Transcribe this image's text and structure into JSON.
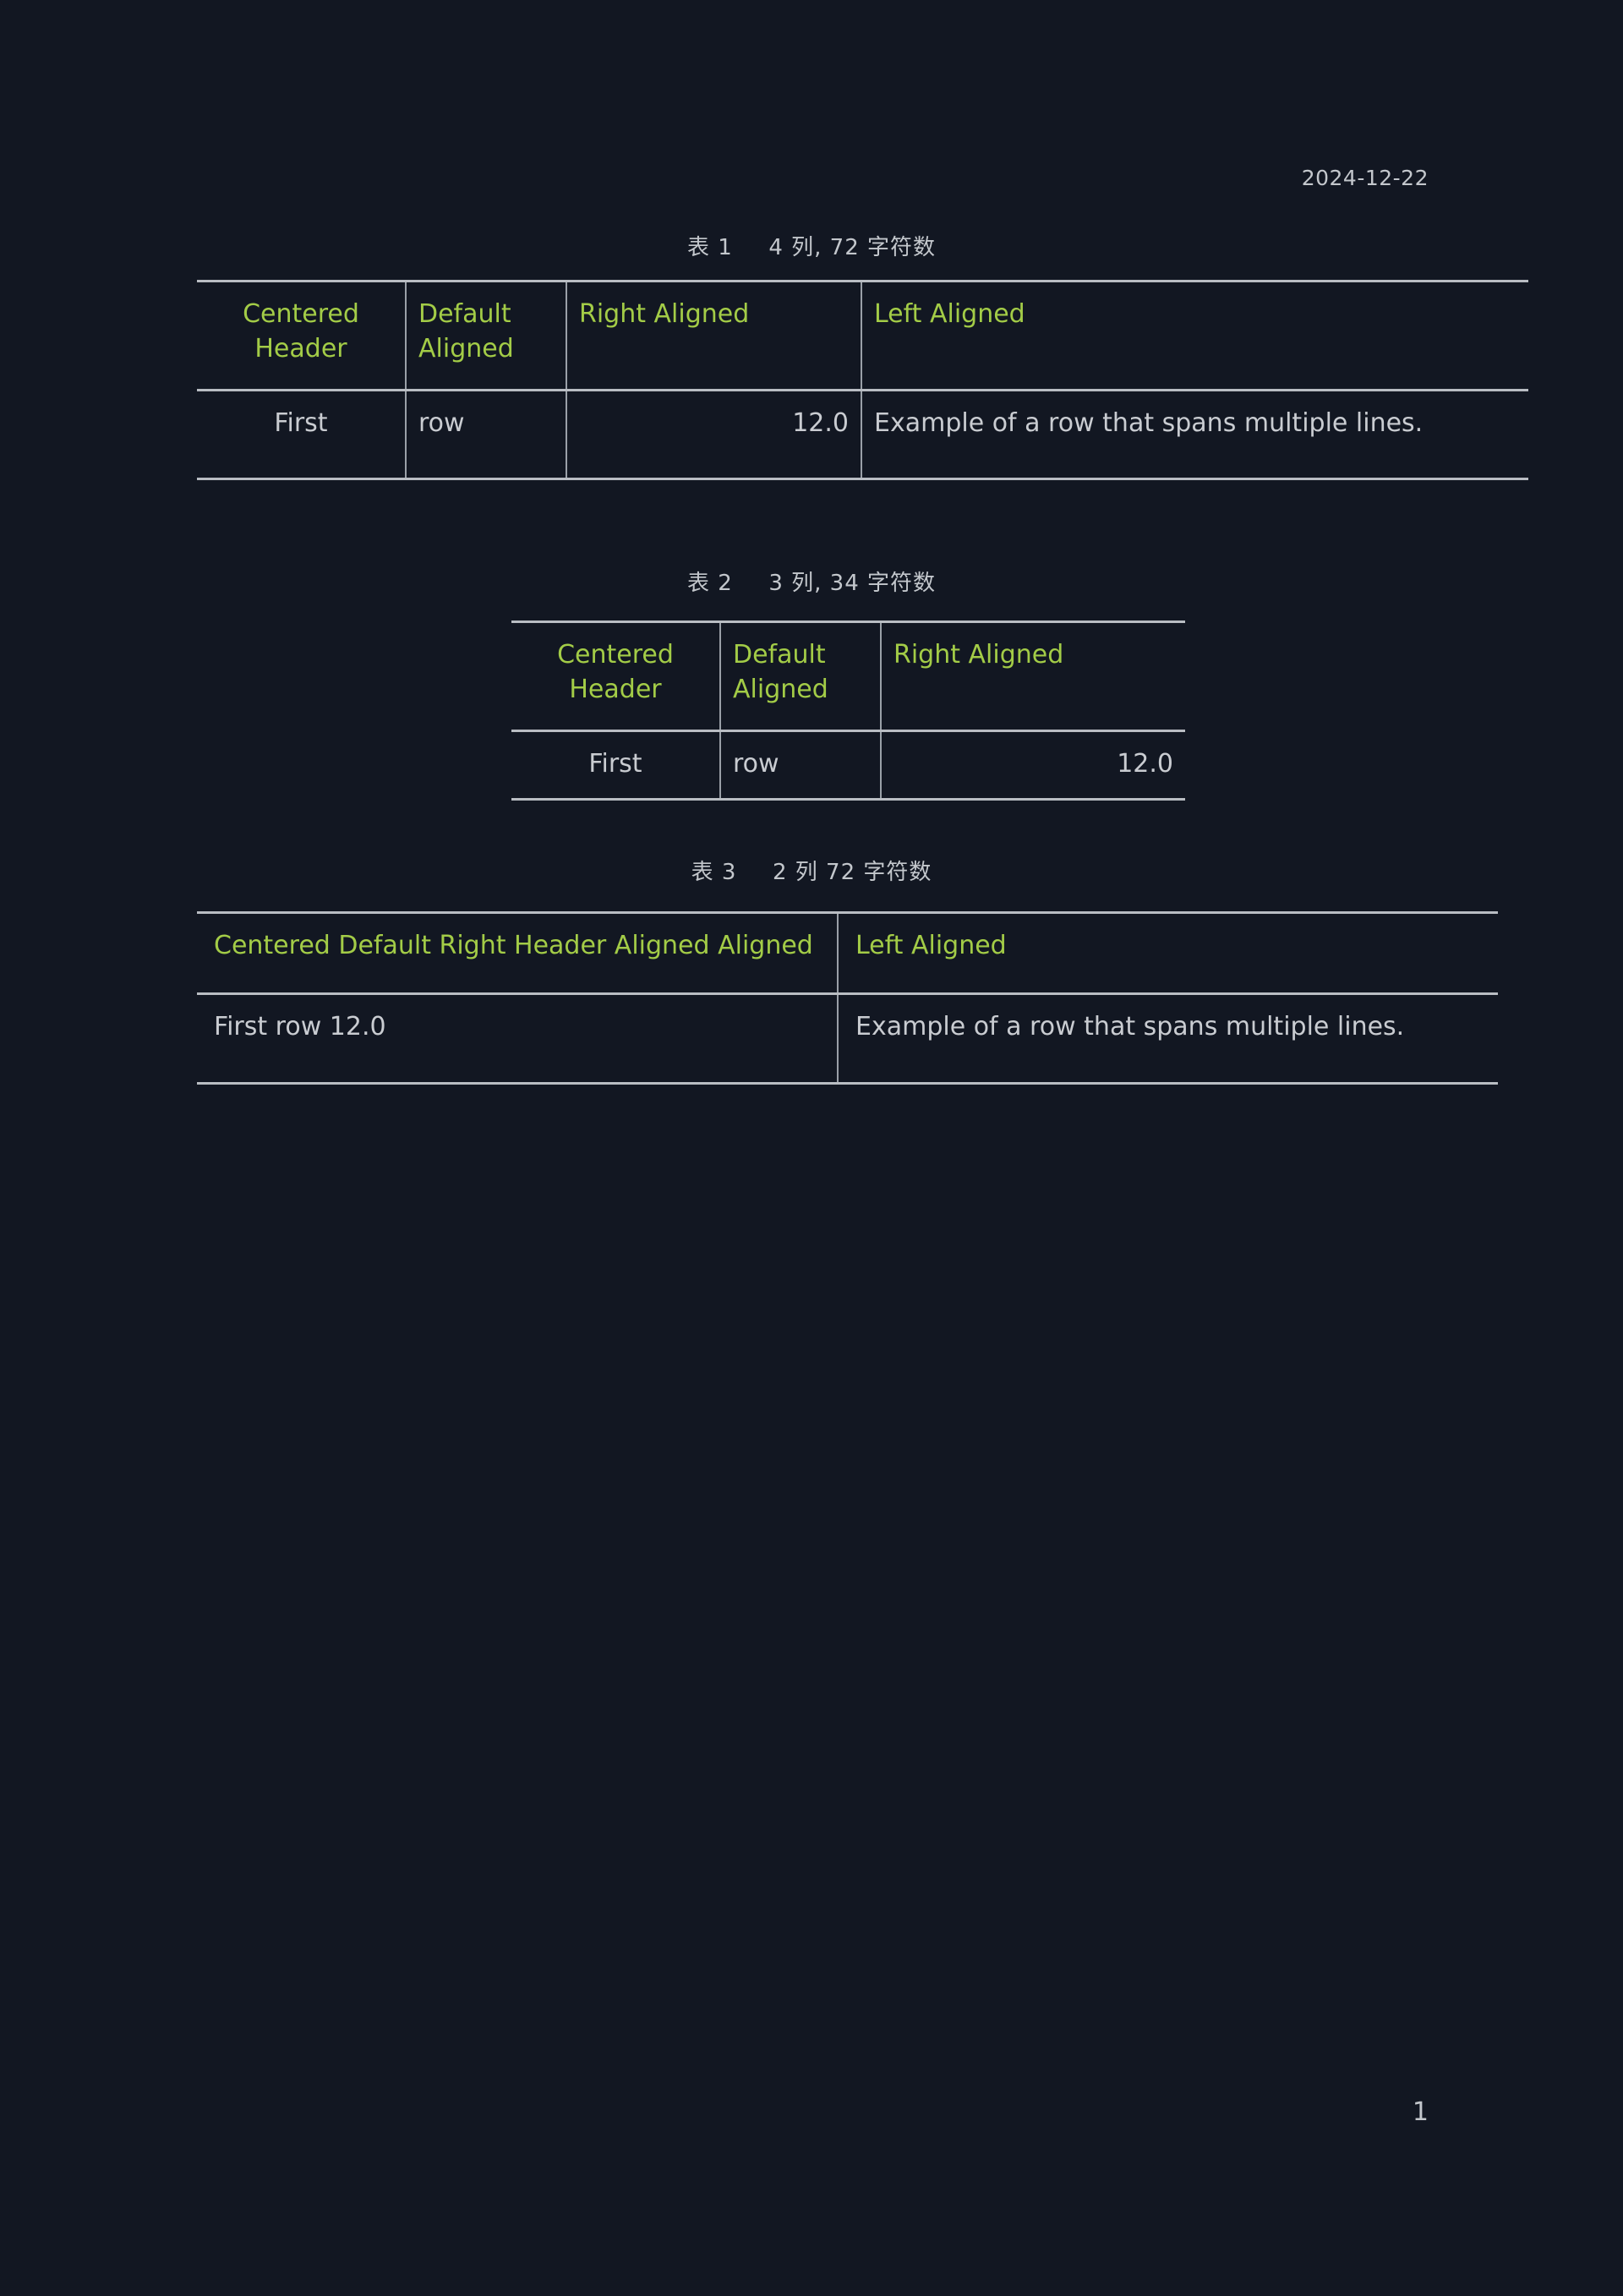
{
  "document": {
    "date": "2024-12-22",
    "page_number": "1",
    "background_color": "#121722",
    "header_color": "#a3cc47",
    "body_color": "#c9ccd1",
    "rule_color": "#b9bdc3"
  },
  "tables": [
    {
      "caption": {
        "label": "表 1",
        "text": "4 列, 72 字符数"
      },
      "columns": 4,
      "headers": [
        {
          "text": "Centered Header",
          "align": "center"
        },
        {
          "text": "Default Aligned",
          "align": "left"
        },
        {
          "text": "Right Aligned",
          "align": "left"
        },
        {
          "text": "Left Aligned",
          "align": "left"
        }
      ],
      "rows": [
        [
          {
            "text": "First",
            "align": "center"
          },
          {
            "text": "row",
            "align": "left"
          },
          {
            "text": "12.0",
            "align": "right"
          },
          {
            "text": "Example of a row that spans multiple lines.",
            "align": "left"
          }
        ]
      ]
    },
    {
      "caption": {
        "label": "表 2",
        "text": "3 列, 34 字符数"
      },
      "columns": 3,
      "headers": [
        {
          "text": "Centered Header",
          "align": "center"
        },
        {
          "text": "Default Aligned",
          "align": "left"
        },
        {
          "text": "Right Aligned",
          "align": "left"
        }
      ],
      "rows": [
        [
          {
            "text": "First",
            "align": "center"
          },
          {
            "text": "row",
            "align": "left"
          },
          {
            "text": "12.0",
            "align": "right"
          }
        ]
      ]
    },
    {
      "caption": {
        "label": "表 3",
        "text": "2 列 72 字符数"
      },
      "columns": 2,
      "headers": [
        {
          "text": "Centered Default Right Header Aligned Aligned",
          "align": "left"
        },
        {
          "text": "Left Aligned",
          "align": "left"
        }
      ],
      "rows": [
        [
          {
            "text": "First row 12.0",
            "align": "left"
          },
          {
            "text": "Example of a row that spans multiple lines.",
            "align": "left"
          }
        ]
      ]
    }
  ]
}
